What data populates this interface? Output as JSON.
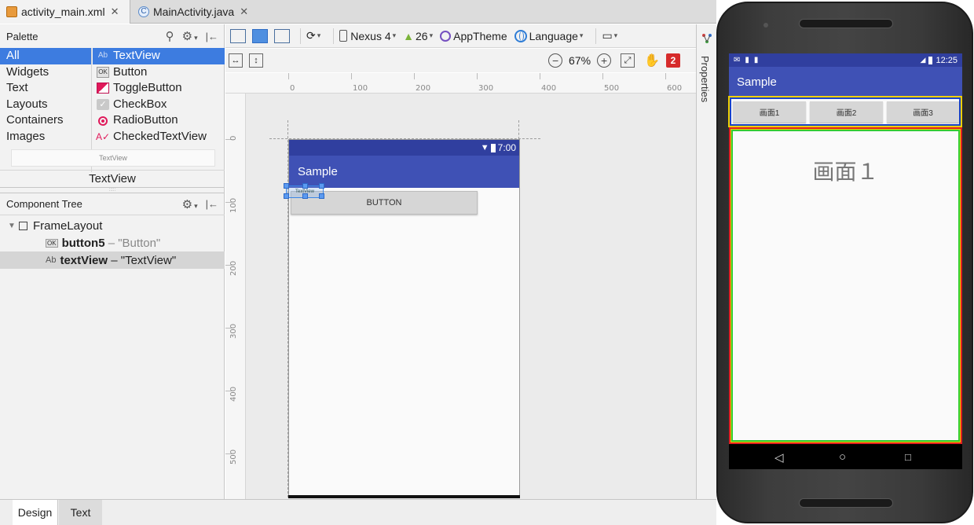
{
  "editor_tabs": [
    {
      "label": "activity_main.xml",
      "icon": "xml-file-icon",
      "active": true
    },
    {
      "label": "MainActivity.java",
      "icon": "java-class-icon",
      "active": false
    }
  ],
  "palette": {
    "title": "Palette",
    "categories": [
      "All",
      "Widgets",
      "Text",
      "Layouts",
      "Containers",
      "Images"
    ],
    "selected_category": "All",
    "widgets": [
      {
        "label": "TextView",
        "icon": "textview-icon",
        "selected": true
      },
      {
        "label": "Button",
        "icon": "button-icon"
      },
      {
        "label": "ToggleButton",
        "icon": "togglebutton-icon"
      },
      {
        "label": "CheckBox",
        "icon": "checkbox-icon"
      },
      {
        "label": "RadioButton",
        "icon": "radiobutton-icon"
      },
      {
        "label": "CheckedTextView",
        "icon": "checkedtextview-icon"
      }
    ],
    "preview_label": "TextView",
    "preview_name": "TextView"
  },
  "component_tree": {
    "title": "Component Tree",
    "root": "FrameLayout",
    "children": [
      {
        "id": "button5",
        "text": "– \"Button\"",
        "type_icon": "OK"
      },
      {
        "id": "textView",
        "text": "– \"TextView\"",
        "type_icon": "Ab",
        "selected": true
      }
    ]
  },
  "toolbar": {
    "device": "Nexus 4",
    "api": "26",
    "theme": "AppTheme",
    "language": "Language",
    "zoom": "67%",
    "error_count": "2"
  },
  "ruler": {
    "h_marks": [
      "0",
      "100",
      "200",
      "300",
      "400",
      "500",
      "600"
    ],
    "v_marks": [
      "0",
      "100",
      "200",
      "300",
      "400",
      "500"
    ]
  },
  "preview_device": {
    "time": "7:00",
    "app_title": "Sample",
    "button_label": "BUTTON",
    "textview_text": "TextView"
  },
  "properties_label": "Properties",
  "bottom_tabs": [
    "Design",
    "Text"
  ],
  "emulator": {
    "time": "12:25",
    "app_title": "Sample",
    "buttons": [
      "画面1",
      "画面2",
      "画面3"
    ],
    "screen_text": "画面１"
  }
}
